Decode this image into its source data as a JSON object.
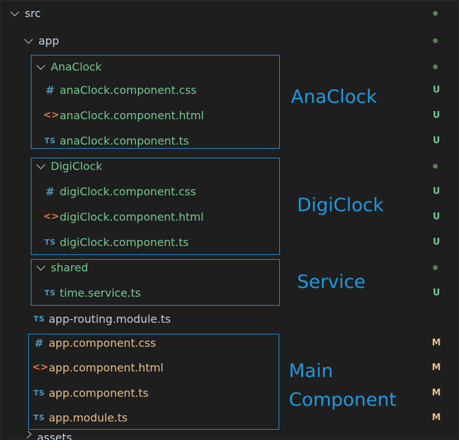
{
  "colors": {
    "background": "#1e1e1e",
    "folder_text": "#c5d5e8",
    "untracked_green": "#73c991",
    "modified_yellow": "#e2c08d",
    "annotation_blue": "#1e9ae0",
    "box_blue": "#1e8fd8",
    "dot_green": "#5a7f5d",
    "dot_gray": "#6f6f6f"
  },
  "tree": {
    "src": {
      "label": "src"
    },
    "app": {
      "label": "app"
    },
    "anaclock_folder": {
      "label": "AnaClock"
    },
    "anaclock_css": {
      "icon": "#",
      "label": "anaClock.component.css",
      "status": "U"
    },
    "anaclock_html": {
      "icon": "<>",
      "label": "anaClock.component.html",
      "status": "U"
    },
    "anaclock_ts": {
      "icon": "TS",
      "label": "anaClock.component.ts",
      "status": "U"
    },
    "digiclock_folder": {
      "label": "DigiClock"
    },
    "digiclock_css": {
      "icon": "#",
      "label": "digiClock.component.css",
      "status": "U"
    },
    "digiclock_html": {
      "icon": "<>",
      "label": "digiClock.component.html",
      "status": "U"
    },
    "digiclock_ts": {
      "icon": "TS",
      "label": "digiClock.component.ts",
      "status": "U"
    },
    "shared_folder": {
      "label": "shared"
    },
    "time_service": {
      "icon": "TS",
      "label": "time.service.ts",
      "status": "U"
    },
    "app_routing": {
      "icon": "TS",
      "label": "app-routing.module.ts"
    },
    "app_css": {
      "icon": "#",
      "label": "app.component.css",
      "status": "M"
    },
    "app_html": {
      "icon": "<>",
      "label": "app.component.html",
      "status": "M"
    },
    "app_ts": {
      "icon": "TS",
      "label": "app.component.ts",
      "status": "M"
    },
    "app_module": {
      "icon": "TS",
      "label": "app.module.ts",
      "status": "M"
    },
    "assets_folder": {
      "label": "assets"
    }
  },
  "annotations": {
    "anaclock": "AnaClock",
    "digiclock": "DigiClock",
    "service": "Service",
    "main_line1": "Main",
    "main_line2": "Component"
  }
}
